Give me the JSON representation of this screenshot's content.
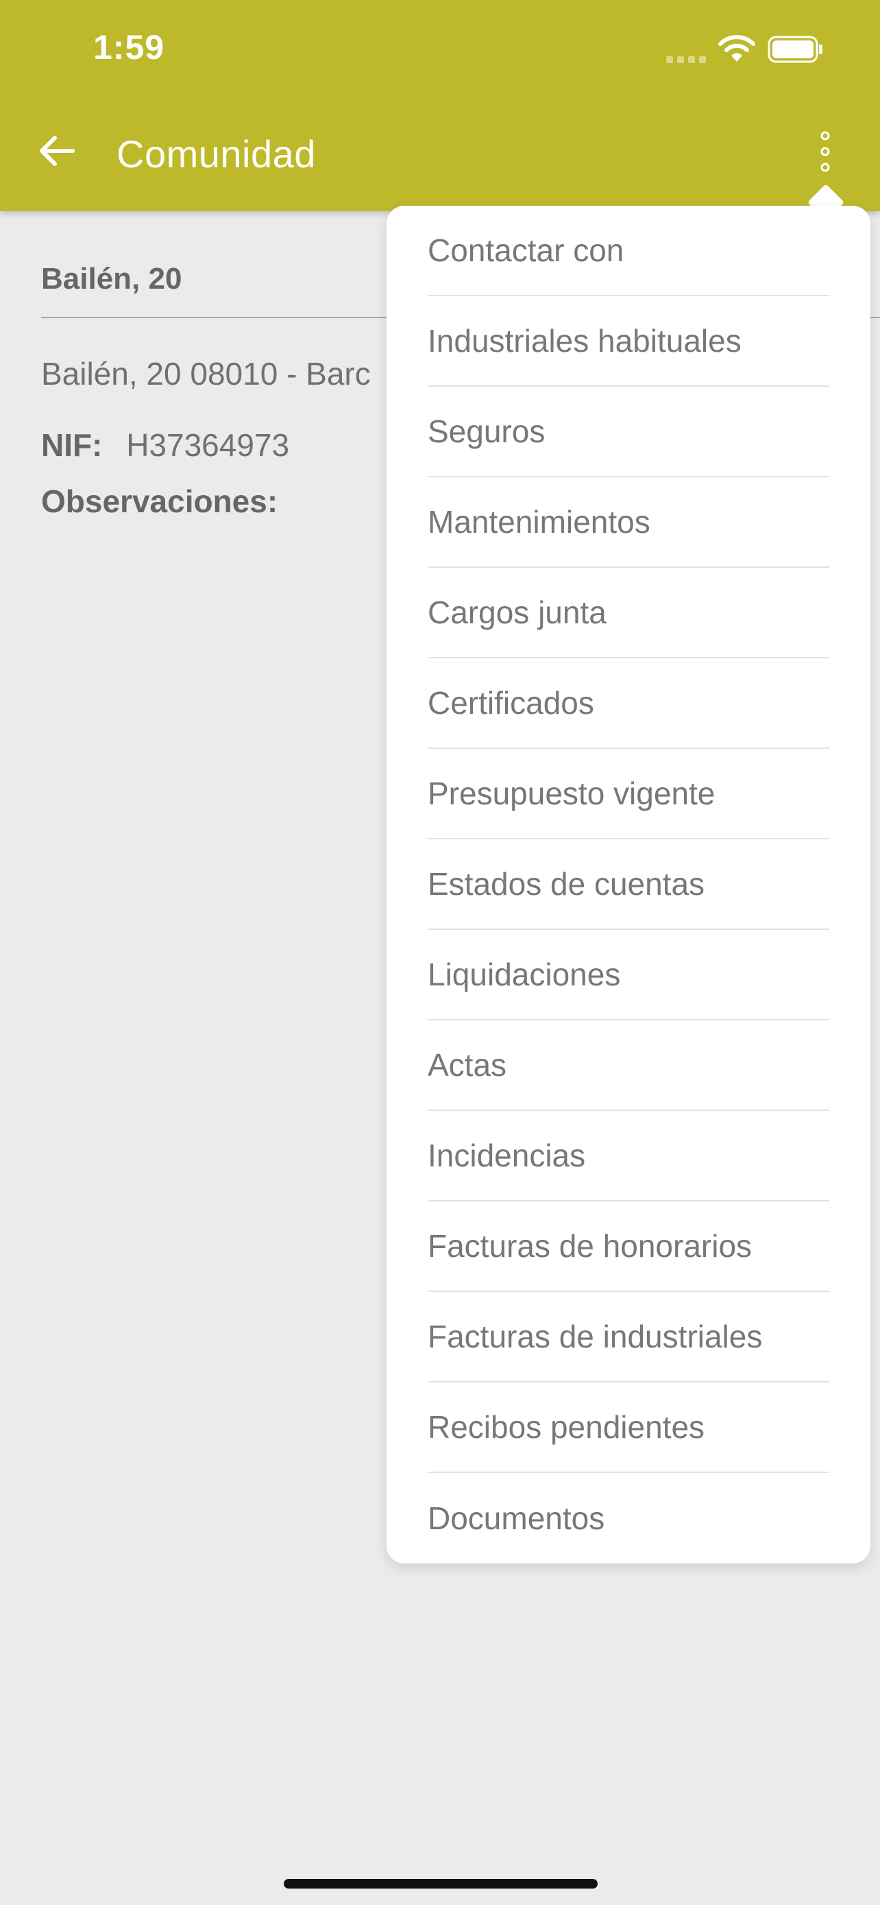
{
  "status_bar": {
    "time": "1:59",
    "icons": [
      "signal-dots-icon",
      "wifi-icon",
      "battery-icon"
    ]
  },
  "app_bar": {
    "back_icon": "arrow-left-icon",
    "title": "Comunidad",
    "more_icon": "more-vertical-icon"
  },
  "community": {
    "name": "Bailén, 20",
    "address": "Bailén, 20  08010 - Barc",
    "nif_label": "NIF:",
    "nif_value": "H37364973",
    "observations_label": "Observaciones:"
  },
  "menu": {
    "items": [
      {
        "label": "Contactar con"
      },
      {
        "label": "Industriales habituales"
      },
      {
        "label": "Seguros"
      },
      {
        "label": "Mantenimientos"
      },
      {
        "label": "Cargos junta"
      },
      {
        "label": "Certificados"
      },
      {
        "label": "Presupuesto vigente"
      },
      {
        "label": "Estados de cuentas"
      },
      {
        "label": "Liquidaciones"
      },
      {
        "label": "Actas"
      },
      {
        "label": "Incidencias"
      },
      {
        "label": "Facturas de honorarios"
      },
      {
        "label": "Facturas de industriales"
      },
      {
        "label": "Recibos pendientes"
      },
      {
        "label": "Documentos"
      }
    ]
  },
  "colors": {
    "header": "#bdb92a",
    "background": "#ebebeb",
    "menu_background": "#ffffff",
    "text_muted": "#777777"
  }
}
